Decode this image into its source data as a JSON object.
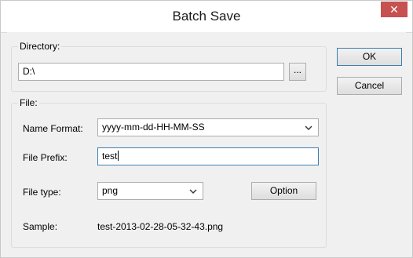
{
  "window": {
    "title": "Batch Save",
    "close_glyph": "✕"
  },
  "directory": {
    "label": "Directory:",
    "value": "D:\\",
    "browse_label": "..."
  },
  "file": {
    "label": "File:",
    "name_format": {
      "label": "Name Format:",
      "value": "yyyy-mm-dd-HH-MM-SS"
    },
    "prefix": {
      "label": "File Prefix:",
      "value": "test"
    },
    "file_type": {
      "label": "File type:",
      "value": "png"
    },
    "option_label": "Option",
    "sample": {
      "label": "Sample:",
      "value": "test-2013-02-28-05-32-43.png"
    }
  },
  "buttons": {
    "ok": "OK",
    "cancel": "Cancel"
  },
  "icons": {
    "dropdown": "chevron-down-icon",
    "close": "close-icon"
  }
}
